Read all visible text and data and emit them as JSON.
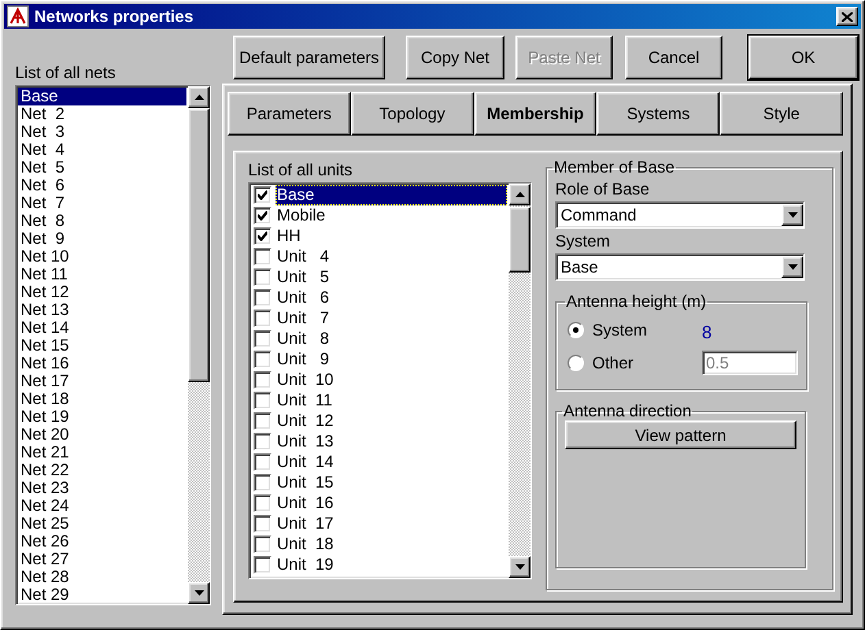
{
  "window": {
    "title": "Networks properties"
  },
  "buttons": [
    {
      "label": "Default parameters",
      "disabled": false,
      "default": false
    },
    {
      "label": "Copy Net",
      "disabled": false,
      "default": false
    },
    {
      "label": "Paste Net",
      "disabled": true,
      "default": false
    },
    {
      "label": "Cancel",
      "disabled": false,
      "default": false
    },
    {
      "label": "OK",
      "disabled": false,
      "default": true
    }
  ],
  "nets": {
    "label": "List of all nets",
    "items": [
      {
        "name": "Base",
        "selected": true
      },
      {
        "name": "Net  2",
        "selected": false
      },
      {
        "name": "Net  3",
        "selected": false
      },
      {
        "name": "Net  4",
        "selected": false
      },
      {
        "name": "Net  5",
        "selected": false
      },
      {
        "name": "Net  6",
        "selected": false
      },
      {
        "name": "Net  7",
        "selected": false
      },
      {
        "name": "Net  8",
        "selected": false
      },
      {
        "name": "Net  9",
        "selected": false
      },
      {
        "name": "Net 10",
        "selected": false
      },
      {
        "name": "Net 11",
        "selected": false
      },
      {
        "name": "Net 12",
        "selected": false
      },
      {
        "name": "Net 13",
        "selected": false
      },
      {
        "name": "Net 14",
        "selected": false
      },
      {
        "name": "Net 15",
        "selected": false
      },
      {
        "name": "Net 16",
        "selected": false
      },
      {
        "name": "Net 17",
        "selected": false
      },
      {
        "name": "Net 18",
        "selected": false
      },
      {
        "name": "Net 19",
        "selected": false
      },
      {
        "name": "Net 20",
        "selected": false
      },
      {
        "name": "Net 21",
        "selected": false
      },
      {
        "name": "Net 22",
        "selected": false
      },
      {
        "name": "Net 23",
        "selected": false
      },
      {
        "name": "Net 24",
        "selected": false
      },
      {
        "name": "Net 25",
        "selected": false
      },
      {
        "name": "Net 26",
        "selected": false
      },
      {
        "name": "Net 27",
        "selected": false
      },
      {
        "name": "Net 28",
        "selected": false
      },
      {
        "name": "Net 29",
        "selected": false
      }
    ]
  },
  "tabs": [
    {
      "label": "Parameters",
      "selected": false
    },
    {
      "label": "Topology",
      "selected": false
    },
    {
      "label": "Membership",
      "selected": true
    },
    {
      "label": "Systems",
      "selected": false
    },
    {
      "label": "Style",
      "selected": false
    }
  ],
  "units": {
    "label": "List of all units",
    "items": [
      {
        "name": "Base",
        "checked": true,
        "selected": true
      },
      {
        "name": "Mobile",
        "checked": true,
        "selected": false
      },
      {
        "name": "HH",
        "checked": true,
        "selected": false
      },
      {
        "name": "Unit   4",
        "checked": false,
        "selected": false
      },
      {
        "name": "Unit   5",
        "checked": false,
        "selected": false
      },
      {
        "name": "Unit   6",
        "checked": false,
        "selected": false
      },
      {
        "name": "Unit   7",
        "checked": false,
        "selected": false
      },
      {
        "name": "Unit   8",
        "checked": false,
        "selected": false
      },
      {
        "name": "Unit   9",
        "checked": false,
        "selected": false
      },
      {
        "name": "Unit  10",
        "checked": false,
        "selected": false
      },
      {
        "name": "Unit  11",
        "checked": false,
        "selected": false
      },
      {
        "name": "Unit  12",
        "checked": false,
        "selected": false
      },
      {
        "name": "Unit  13",
        "checked": false,
        "selected": false
      },
      {
        "name": "Unit  14",
        "checked": false,
        "selected": false
      },
      {
        "name": "Unit  15",
        "checked": false,
        "selected": false
      },
      {
        "name": "Unit  16",
        "checked": false,
        "selected": false
      },
      {
        "name": "Unit  17",
        "checked": false,
        "selected": false
      },
      {
        "name": "Unit  18",
        "checked": false,
        "selected": false
      },
      {
        "name": "Unit  19",
        "checked": false,
        "selected": false
      }
    ]
  },
  "member": {
    "title": "Member of Base",
    "role": {
      "label": "Role of Base",
      "value": "Command"
    },
    "system": {
      "label": "System",
      "value": "Base"
    },
    "antenna_height": {
      "title": "Antenna height (m)",
      "options": [
        {
          "kind": "reading",
          "label": "System",
          "selected": true,
          "value": "8"
        },
        {
          "kind": "field",
          "label": "Other",
          "selected": false,
          "value": "0.5",
          "disabled": true
        }
      ]
    },
    "antenna_direction": {
      "title": "Antenna direction",
      "button": "View pattern"
    }
  }
}
